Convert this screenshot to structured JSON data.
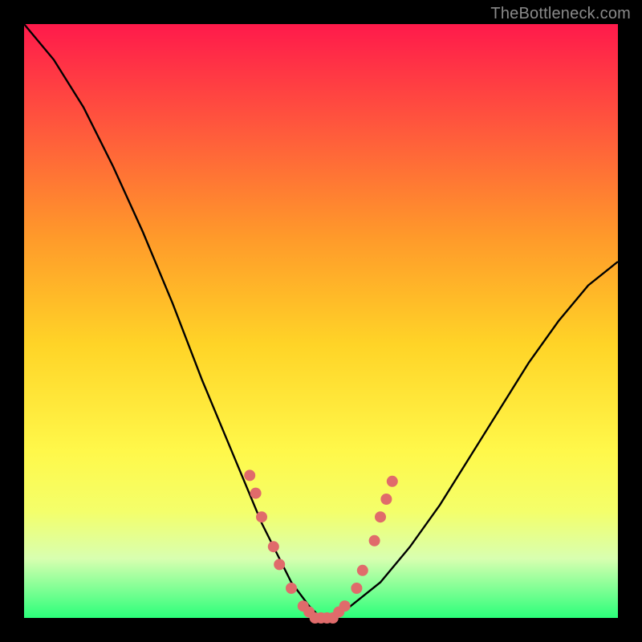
{
  "watermark": "TheBottleneck.com",
  "colors": {
    "background": "#000000",
    "gradient_top": "#ff1a4b",
    "gradient_bottom": "#2bff7a",
    "curve": "#000000",
    "marker": "#e06b6b"
  },
  "chart_data": {
    "type": "line",
    "title": "",
    "xlabel": "",
    "ylabel": "",
    "xlim": [
      0,
      100
    ],
    "ylim": [
      0,
      100
    ],
    "series": [
      {
        "name": "bottleneck-curve",
        "x": [
          0,
          5,
          10,
          15,
          20,
          25,
          30,
          35,
          40,
          45,
          48,
          50,
          52,
          55,
          60,
          65,
          70,
          75,
          80,
          85,
          90,
          95,
          100
        ],
        "y": [
          100,
          94,
          86,
          76,
          65,
          53,
          40,
          28,
          16,
          6,
          2,
          0,
          0,
          2,
          6,
          12,
          19,
          27,
          35,
          43,
          50,
          56,
          60
        ]
      }
    ],
    "markers": [
      {
        "x": 38,
        "y": 24
      },
      {
        "x": 39,
        "y": 21
      },
      {
        "x": 40,
        "y": 17
      },
      {
        "x": 42,
        "y": 12
      },
      {
        "x": 43,
        "y": 9
      },
      {
        "x": 45,
        "y": 5
      },
      {
        "x": 47,
        "y": 2
      },
      {
        "x": 48,
        "y": 1
      },
      {
        "x": 49,
        "y": 0
      },
      {
        "x": 50,
        "y": 0
      },
      {
        "x": 51,
        "y": 0
      },
      {
        "x": 52,
        "y": 0
      },
      {
        "x": 53,
        "y": 1
      },
      {
        "x": 54,
        "y": 2
      },
      {
        "x": 56,
        "y": 5
      },
      {
        "x": 57,
        "y": 8
      },
      {
        "x": 59,
        "y": 13
      },
      {
        "x": 60,
        "y": 17
      },
      {
        "x": 61,
        "y": 20
      },
      {
        "x": 62,
        "y": 23
      }
    ],
    "annotations": []
  }
}
